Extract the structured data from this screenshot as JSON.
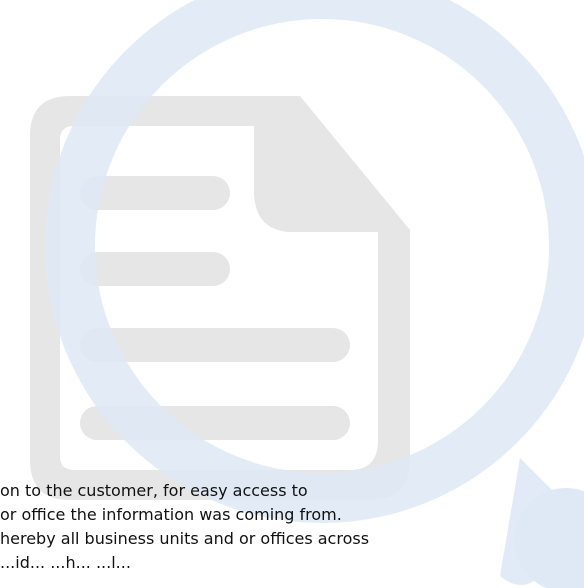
{
  "illustration": {
    "icon": "document-search-icon",
    "colors": {
      "document": "#e6e6e6",
      "magnifier": "#dfe9f5",
      "text_lines": "#e6e6e6"
    }
  },
  "body_text": {
    "lines": [
      "on to the customer, for easy access to",
      " or office the information was coming from.",
      "hereby all business units and or offices across",
      "...id... ...h... ...l..."
    ]
  }
}
